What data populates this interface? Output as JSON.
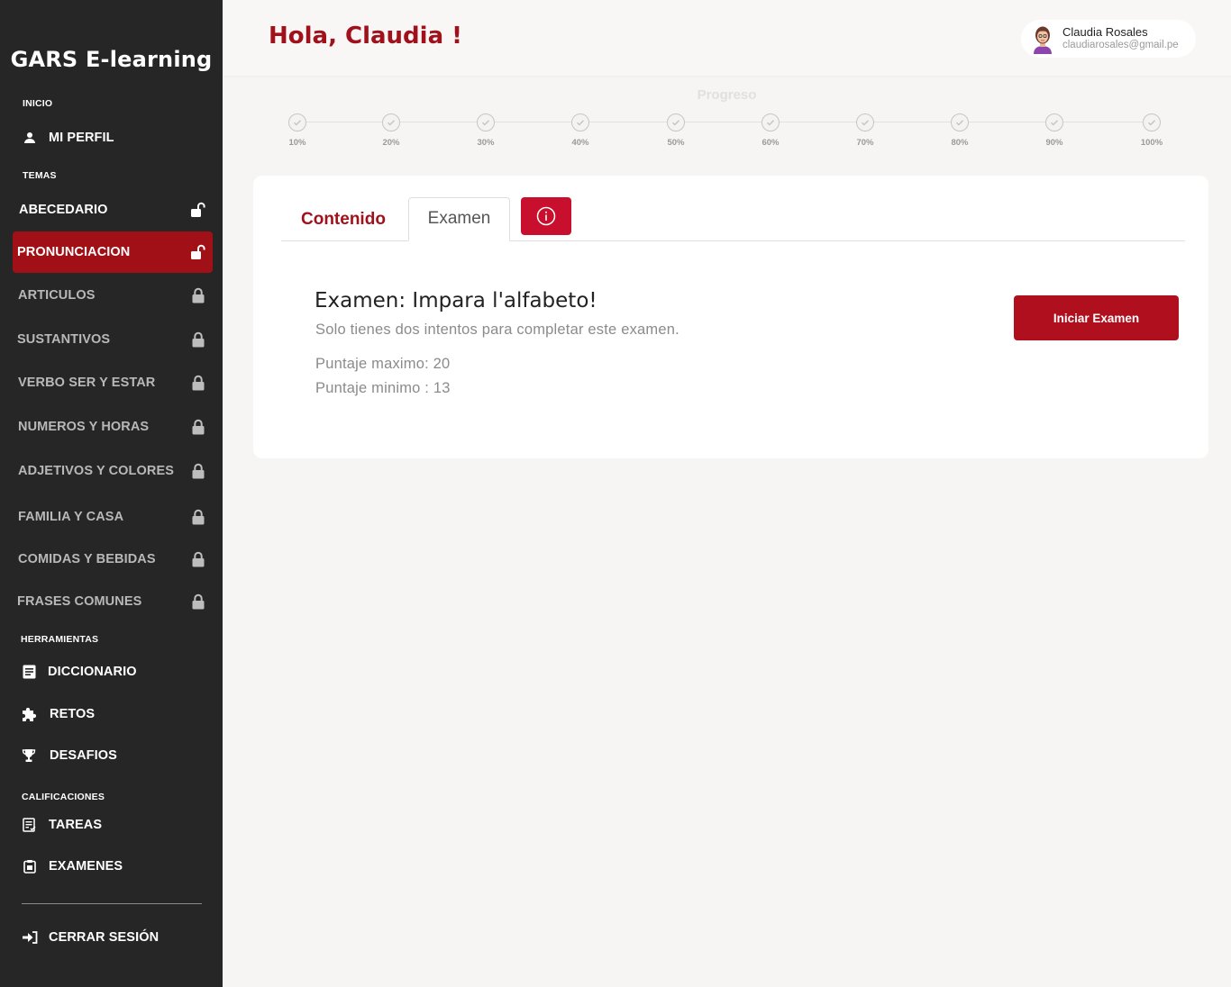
{
  "brand": "GARS E-learning",
  "sections": {
    "inicio": "INICIO",
    "temas": "TEMAS",
    "herramientas": "HERRAMIENTAS",
    "calificaciones": "CALIFICACIONES"
  },
  "nav": {
    "perfil": "MI PERFIL",
    "cerrar": "CERRAR SESIÓN"
  },
  "topics": [
    {
      "label": "ABECEDARIO",
      "status": "unlocked"
    },
    {
      "label": "PRONUNCIACION",
      "status": "active"
    },
    {
      "label": "ARTICULOS",
      "status": "locked"
    },
    {
      "label": "SUSTANTIVOS",
      "status": "locked"
    },
    {
      "label": "VERBO SER Y ESTAR",
      "status": "locked"
    },
    {
      "label": "NUMEROS Y HORAS",
      "status": "locked"
    },
    {
      "label": "ADJETIVOS Y COLORES",
      "status": "locked"
    },
    {
      "label": "FAMILIA Y CASA",
      "status": "locked"
    },
    {
      "label": "COMIDAS Y BEBIDAS",
      "status": "locked"
    },
    {
      "label": "FRASES COMUNES",
      "status": "locked"
    }
  ],
  "tools": [
    {
      "label": "DICCIONARIO",
      "icon": "book-icon"
    },
    {
      "label": "RETOS",
      "icon": "puzzle-icon"
    },
    {
      "label": "DESAFIOS",
      "icon": "trophy-icon"
    }
  ],
  "grades": [
    {
      "label": "TAREAS",
      "icon": "assignment-icon"
    },
    {
      "label": "EXAMENES",
      "icon": "clipboard-icon"
    }
  ],
  "header": {
    "greeting": "Hola, Claudia !",
    "user_name": "Claudia Rosales",
    "user_email": "claudiarosales@gmail.pe"
  },
  "progress": {
    "title": "Progreso",
    "steps": [
      "10%",
      "20%",
      "30%",
      "40%",
      "50%",
      "60%",
      "70%",
      "80%",
      "90%",
      "100%"
    ]
  },
  "tabs": {
    "contenido": "Contenido",
    "examen": "Examen"
  },
  "exam": {
    "title": "Examen: Impara l'alfabeto!",
    "subtitle": "Solo tienes dos intentos para completar este examen.",
    "max_score": "Puntaje maximo: 20",
    "min_score": "Puntaje minimo : 13",
    "start_label": "Iniciar Examen"
  },
  "colors": {
    "accent": "#a0111c",
    "sidebar_bg": "#262626",
    "active_item": "#a11016",
    "button": "#b0101e"
  }
}
